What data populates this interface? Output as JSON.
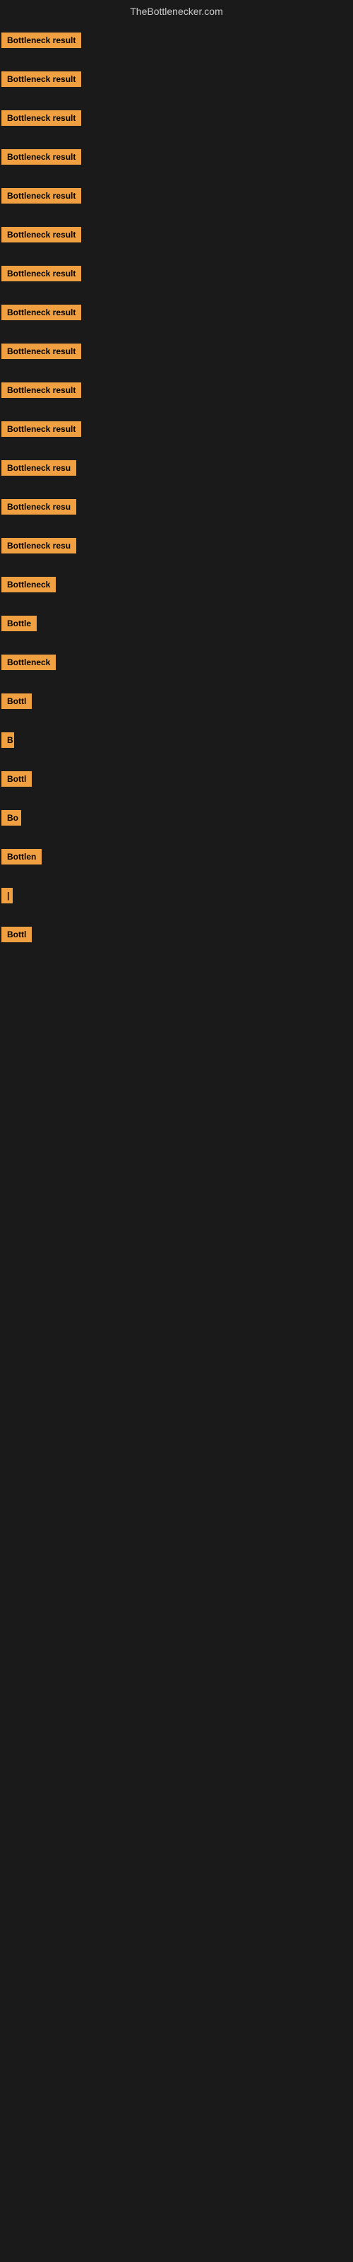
{
  "site": {
    "title": "TheBottlenecker.com"
  },
  "bars": [
    {
      "label": "Bottleneck result",
      "width": 155
    },
    {
      "label": "Bottleneck result",
      "width": 155
    },
    {
      "label": "Bottleneck result",
      "width": 155
    },
    {
      "label": "Bottleneck result",
      "width": 155
    },
    {
      "label": "Bottleneck result",
      "width": 155
    },
    {
      "label": "Bottleneck result",
      "width": 155
    },
    {
      "label": "Bottleneck result",
      "width": 155
    },
    {
      "label": "Bottleneck result",
      "width": 155
    },
    {
      "label": "Bottleneck result",
      "width": 155
    },
    {
      "label": "Bottleneck result",
      "width": 155
    },
    {
      "label": "Bottleneck result",
      "width": 155
    },
    {
      "label": "Bottleneck resu",
      "width": 140
    },
    {
      "label": "Bottleneck resu",
      "width": 135
    },
    {
      "label": "Bottleneck resu",
      "width": 130
    },
    {
      "label": "Bottleneck",
      "width": 95
    },
    {
      "label": "Bottle",
      "width": 60
    },
    {
      "label": "Bottleneck",
      "width": 90
    },
    {
      "label": "Bottl",
      "width": 50
    },
    {
      "label": "B",
      "width": 18
    },
    {
      "label": "Bottl",
      "width": 52
    },
    {
      "label": "Bo",
      "width": 28
    },
    {
      "label": "Bottlen",
      "width": 68
    },
    {
      "label": "|",
      "width": 10
    },
    {
      "label": "Bottl",
      "width": 50
    }
  ]
}
